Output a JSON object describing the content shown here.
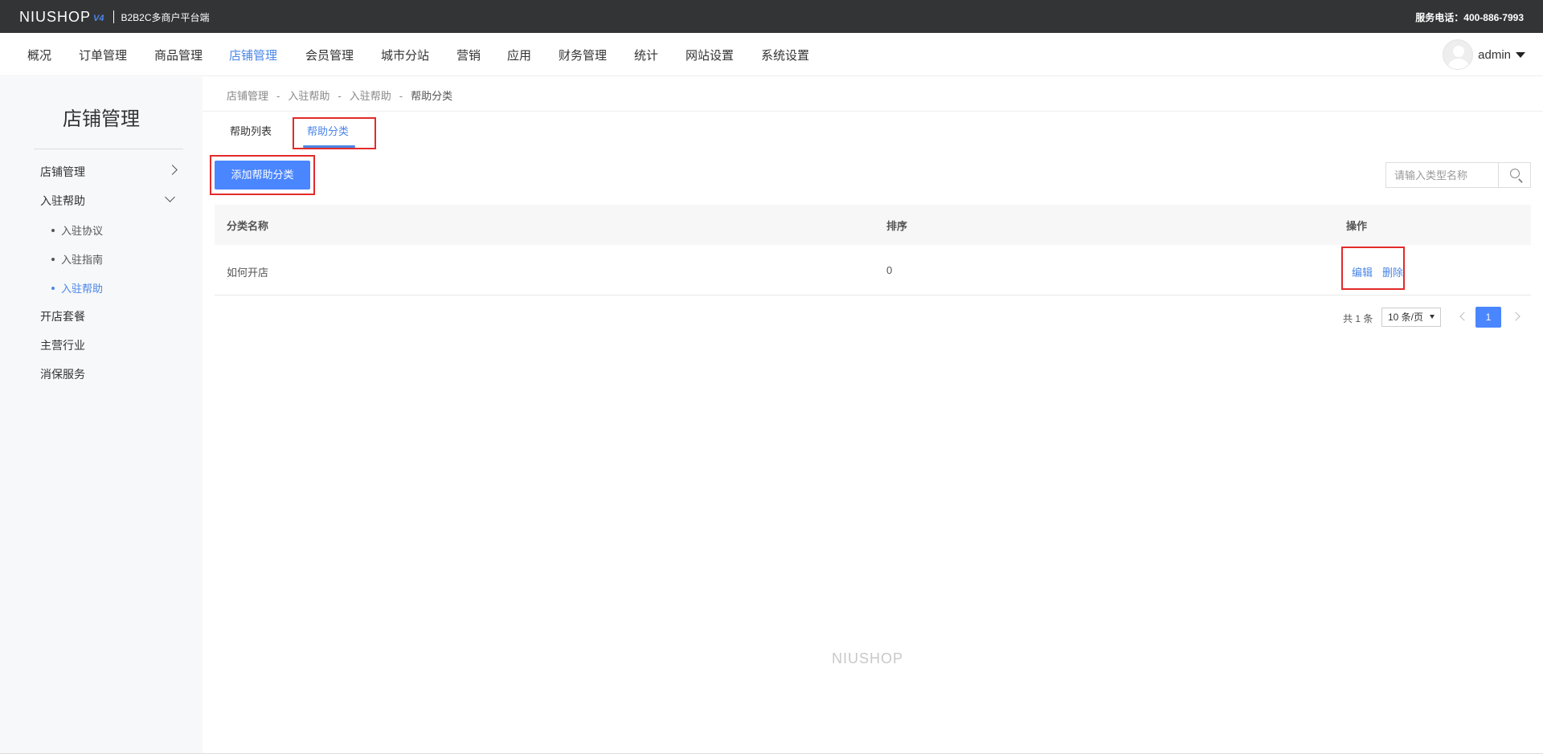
{
  "topbar": {
    "logo": "NIUSHOP",
    "logo_version": "V4",
    "subtitle": "B2B2C多商户平台端",
    "service_phone": "服务电话：400-886-7993"
  },
  "nav": {
    "items": [
      "概况",
      "订单管理",
      "商品管理",
      "店铺管理",
      "会员管理",
      "城市分站",
      "营销",
      "应用",
      "财务管理",
      "统计",
      "网站设置",
      "系统设置"
    ],
    "active": "店铺管理",
    "user_name": "admin"
  },
  "sidebar": {
    "title": "店铺管理",
    "items": [
      {
        "label": "店铺管理"
      },
      {
        "label": "入驻帮助"
      },
      {
        "label": "开店套餐"
      },
      {
        "label": "主营行业"
      },
      {
        "label": "消保服务"
      }
    ],
    "sub_items": [
      "入驻协议",
      "入驻指南",
      "入驻帮助"
    ],
    "active_sub": "入驻帮助"
  },
  "breadcrumb": [
    "店铺管理",
    "入驻帮助",
    "入驻帮助",
    "帮助分类"
  ],
  "tabs": [
    "帮助列表",
    "帮助分类"
  ],
  "active_tab": "帮助分类",
  "toolbar": {
    "add_label": "添加帮助分类",
    "search_placeholder": "请输入类型名称"
  },
  "table": {
    "headers": [
      "分类名称",
      "排序",
      "操作"
    ],
    "rows": [
      {
        "name": "如何开店",
        "sort": "0",
        "actions": [
          "编辑",
          "删除"
        ]
      }
    ]
  },
  "pagination": {
    "total": "共 1 条",
    "page_size": "10 条/页",
    "current_page": "1"
  },
  "footer": {
    "logo": "NIUSHOP"
  },
  "colors": {
    "accent": "#4a86ff",
    "highlight": "#e32a2a",
    "topbar": "#333436"
  }
}
